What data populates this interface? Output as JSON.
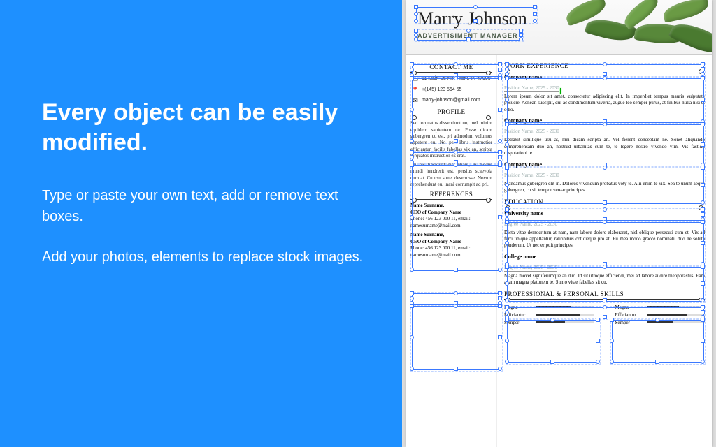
{
  "promo": {
    "headline": "Every object can be easily modified.",
    "p1": "Type or paste your own text, add or remove text boxes.",
    "p2": "Add your photos, elements to replace stock images."
  },
  "resume": {
    "name": "Marry Johnson",
    "role": "ADVERTISIMENT MANAGER",
    "contact": {
      "heading": "CONTACT ME",
      "address": "11 Main St. New York, IN 47000",
      "phone": "+(145) 123 564 55",
      "email": "marry-johnson@gmail.com"
    },
    "profile": {
      "heading": "PROFILE",
      "p1": "Sed torquatos dissentiunt no, mel minim equidem sapientem ne. Posse dicam gubergren cu est, pri admodum volumus appetere eu. No per libris instructior efficiantur, facilis fabellas vix an, scripta torquatos instructior ex erat.",
      "p2": "An his tincidunt dissentiant, in modus mundi hendrerit est, persius scaevola cum at. Cu usu sonet deseruisse. Novum reprehendunt eu, inani corrumpit ad pri."
    },
    "references": {
      "heading": "REFERENCES",
      "items": [
        {
          "name": "Name Surname,",
          "title": "CEO of Company Name",
          "phone": "Phone: 456 123 000 11, email:",
          "email": "namesurname@mail.com"
        },
        {
          "name": "Name Surname,",
          "title": "CEO of Company Name",
          "phone": "Phone: 456 123 000 11, email:",
          "email": "namesurname@mail.com"
        }
      ]
    },
    "work": {
      "heading": "WORK EXPERIENCE",
      "items": [
        {
          "company": "Company name",
          "position": "Position Name, 2025 - 2030",
          "body": "Lorem ipsum dolor sit amet, consectetur adipiscing elit. In imperdiet tempus mauris vulputate posuere. Aenean suscipit, dui ac condimentum viverra, augue leo semper purus, at finibus nulla nisi et odio."
        },
        {
          "company": "Company name",
          "position": "Position Name, 2025 - 2030",
          "body": "Detraxit similique usu at, mei dicam scripta an. Vel fierent conceptam ne. Sonet aliquando comprehensam duo an, nostrud urbanitas cum te, te legere nostro vivendo vim. Vis fastidii disputationi te."
        },
        {
          "company": "Company name",
          "position": "Position Name, 2025 - 2030",
          "body": "Mandamus gubergren elit in. Dolores vivendum probatus voty te. Alii enim te vix. Sea te unum aeque gubergren, cu sit tempor verear principes."
        }
      ]
    },
    "education": {
      "heading": "EDUCATION",
      "items": [
        {
          "school": "University name",
          "degree": "Degree Name, 2025 - 2030",
          "body": "Dicta vitae democritum at nam, nam labore dolore elaboraret, nisl oblique persecuti cum et. Vix ad ferri ubique appellantur, rationibus cotidieque pro at. Eu mea modo gracce nominati, duo ne soluta ponderum. Ut nec eripuit principes."
        },
        {
          "school": "College name",
          "degree": "Degree Name, 2025 - 2030",
          "body": "Magna movet signiferumque an duo. Id sit utroque efficiendi, mei ad labore audire theophrastus. Eam agam magna platonem te. Sumo vitae fabellas sit cu."
        }
      ]
    },
    "skills": {
      "heading": "PROFESSIONAL & PERSONAL SKILLS",
      "left": [
        {
          "name": "Magna",
          "pct": 60
        },
        {
          "name": "Efficiantur",
          "pct": 75
        },
        {
          "name": "Semper",
          "pct": 50
        }
      ],
      "right": [
        {
          "name": "Magna",
          "pct": 55
        },
        {
          "name": "Efficiantur",
          "pct": 70
        },
        {
          "name": "Semper",
          "pct": 45
        }
      ]
    }
  }
}
